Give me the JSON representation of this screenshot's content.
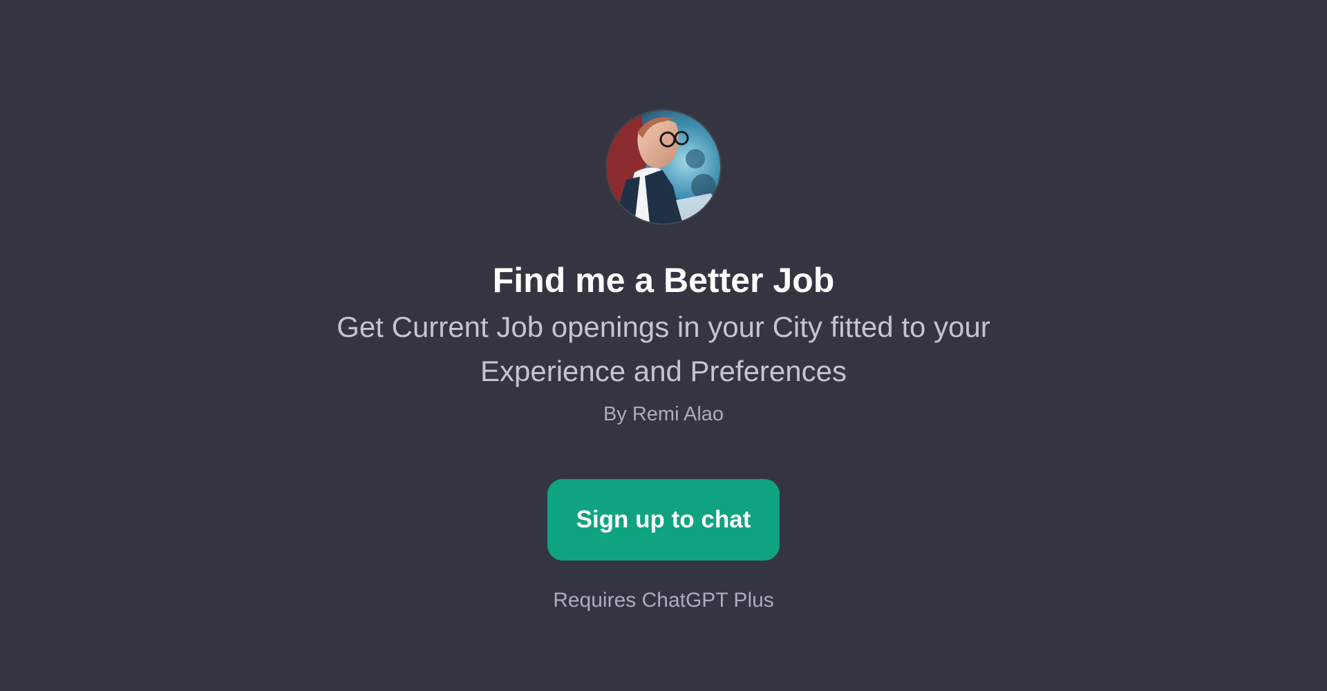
{
  "gpt": {
    "title": "Find me a Better Job",
    "description": "Get Current Job openings in your City fitted to your Experience and Preferences",
    "author": "By Remi Alao",
    "avatar_icon": "professional-woman-avatar"
  },
  "actions": {
    "signup_label": "Sign up to chat",
    "requirement": "Requires ChatGPT Plus"
  },
  "colors": {
    "background": "#343541",
    "accent": "#10a37f",
    "title": "#ffffff",
    "muted": "#acacbe"
  }
}
